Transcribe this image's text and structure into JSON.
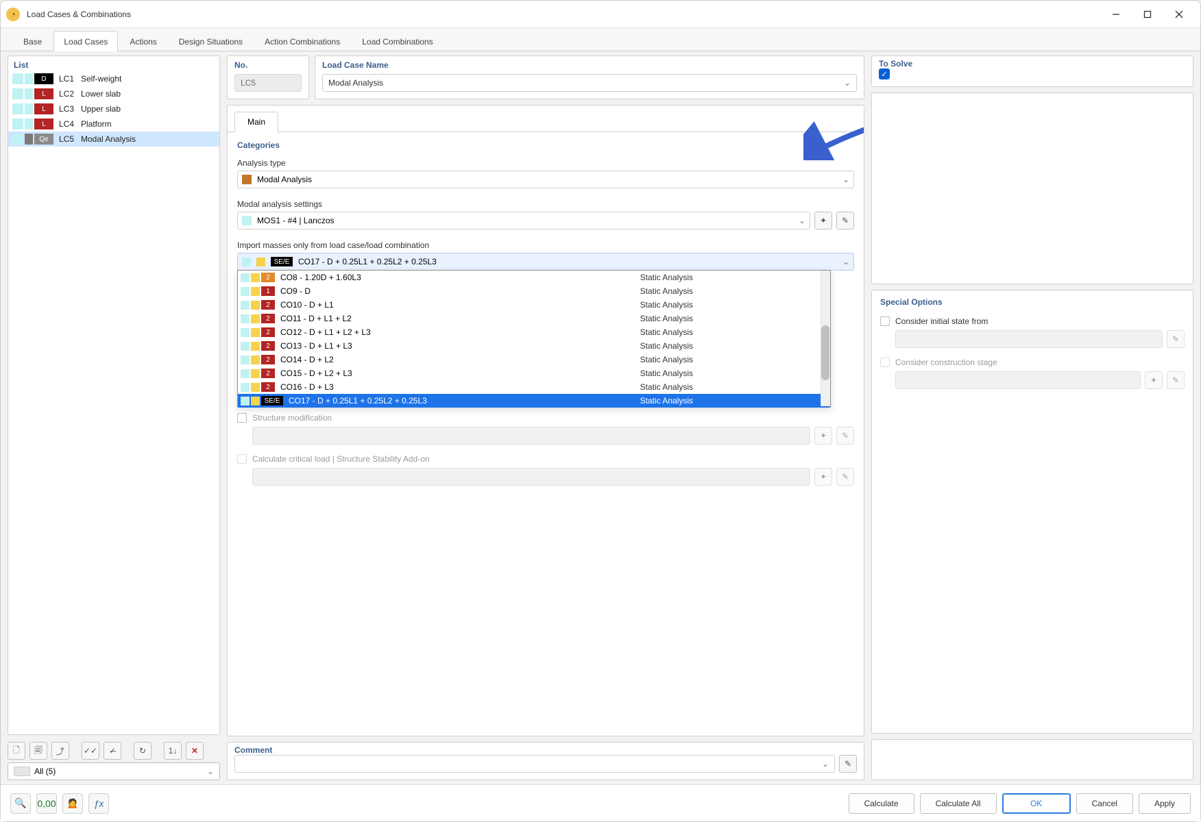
{
  "window": {
    "title": "Load Cases & Combinations"
  },
  "tabs": [
    "Base",
    "Load Cases",
    "Actions",
    "Design Situations",
    "Action Combinations",
    "Load Combinations"
  ],
  "active_tab": "Load Cases",
  "list": {
    "header": "List",
    "items": [
      {
        "id": "LC1",
        "name": "Self-weight",
        "badge": "D",
        "badge_color": "#000000",
        "selected": false
      },
      {
        "id": "LC2",
        "name": "Lower slab",
        "badge": "L",
        "badge_color": "#b32424",
        "selected": false
      },
      {
        "id": "LC3",
        "name": "Upper slab",
        "badge": "L",
        "badge_color": "#b32424",
        "selected": false
      },
      {
        "id": "LC4",
        "name": "Platform",
        "badge": "L",
        "badge_color": "#b32424",
        "selected": false
      },
      {
        "id": "LC5",
        "name": "Modal Analysis",
        "badge": "Qe",
        "badge_color": "#8a8a8a",
        "selected": true
      }
    ],
    "filter": "All (5)"
  },
  "no": {
    "label": "No.",
    "value": "LC5"
  },
  "lcname": {
    "label": "Load Case Name",
    "value": "Modal Analysis"
  },
  "main_tab": "Main",
  "categories": {
    "header": "Categories",
    "analysis_type_label": "Analysis type",
    "analysis_type_value": "Modal Analysis",
    "modal_settings_label": "Modal analysis settings",
    "modal_settings_value": "MOS1 - #4 | Lanczos",
    "import_label": "Import masses only from load case/load combination",
    "import_value": "CO17 - D + 0.25L1 + 0.25L2 + 0.25L3",
    "import_badge": "SE/E"
  },
  "dropdown_items": [
    {
      "num": "2",
      "num_color": "#e08a2a",
      "name": "CO8 - 1.20D + 1.60L3",
      "type": "Static Analysis",
      "sel": false
    },
    {
      "num": "1",
      "num_color": "#b32424",
      "name": "CO9 - D",
      "type": "Static Analysis",
      "sel": false
    },
    {
      "num": "2",
      "num_color": "#b32424",
      "name": "CO10 - D + L1",
      "type": "Static Analysis",
      "sel": false
    },
    {
      "num": "2",
      "num_color": "#b32424",
      "name": "CO11 - D + L1 + L2",
      "type": "Static Analysis",
      "sel": false
    },
    {
      "num": "2",
      "num_color": "#b32424",
      "name": "CO12 - D + L1 + L2 + L3",
      "type": "Static Analysis",
      "sel": false
    },
    {
      "num": "2",
      "num_color": "#b32424",
      "name": "CO13 - D + L1 + L3",
      "type": "Static Analysis",
      "sel": false
    },
    {
      "num": "2",
      "num_color": "#b32424",
      "name": "CO14 - D + L2",
      "type": "Static Analysis",
      "sel": false
    },
    {
      "num": "2",
      "num_color": "#b32424",
      "name": "CO15 - D + L2 + L3",
      "type": "Static Analysis",
      "sel": false
    },
    {
      "num": "2",
      "num_color": "#b32424",
      "name": "CO16 - D + L3",
      "type": "Static Analysis",
      "sel": false
    },
    {
      "num": "SE/E",
      "num_color": "#000000",
      "name": "CO17 - D + 0.25L1 + 0.25L2 + 0.25L3",
      "type": "Static Analysis",
      "sel": true
    }
  ],
  "options": {
    "structure_modification": "Structure modification",
    "calculate_critical": "Calculate critical load | Structure Stability Add-on"
  },
  "comment": {
    "label": "Comment",
    "value": ""
  },
  "tosolve": {
    "label": "To Solve"
  },
  "special": {
    "header": "Special Options",
    "initial_state": "Consider initial state from",
    "construction_stage": "Consider construction stage"
  },
  "footer": {
    "calculate": "Calculate",
    "calculate_all": "Calculate All",
    "ok": "OK",
    "cancel": "Cancel",
    "apply": "Apply"
  }
}
